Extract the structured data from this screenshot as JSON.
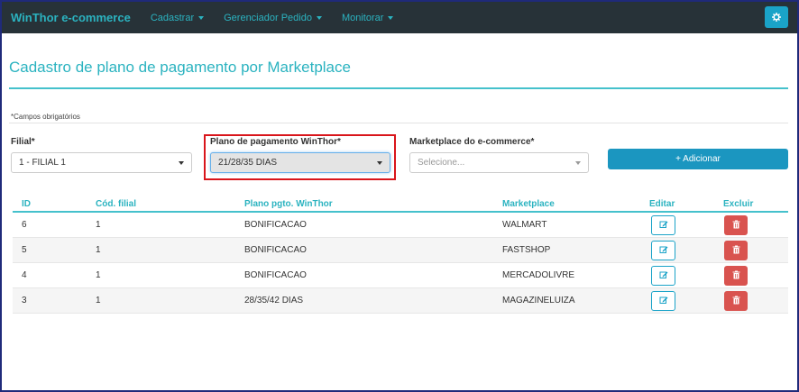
{
  "navbar": {
    "brand": "WinThor e-commerce",
    "items": [
      {
        "label": "Cadastrar"
      },
      {
        "label": "Gerenciador Pedido"
      },
      {
        "label": "Monitorar"
      }
    ],
    "settings_icon": "gear-icon"
  },
  "page": {
    "title": "Cadastro de plano de pagamento por Marketplace",
    "required_note": "*Campos obrigatórios"
  },
  "form": {
    "filial": {
      "label": "Filial*",
      "value": "1 - FILIAL 1"
    },
    "plano": {
      "label": "Plano de pagamento WinThor*",
      "value": "21/28/35 DIAS"
    },
    "marketplace": {
      "label": "Marketplace do e-commerce*",
      "placeholder": "Selecione..."
    },
    "add_button": "+ Adicionar"
  },
  "table": {
    "headers": {
      "id": "ID",
      "cod_filial": "Cód. filial",
      "plano": "Plano pgto. WinThor",
      "marketplace": "Marketplace",
      "editar": "Editar",
      "excluir": "Excluir"
    },
    "rows": [
      {
        "id": "6",
        "filial": "1",
        "plano": "BONIFICACAO",
        "marketplace": "WALMART"
      },
      {
        "id": "5",
        "filial": "1",
        "plano": "BONIFICACAO",
        "marketplace": "FASTSHOP"
      },
      {
        "id": "4",
        "filial": "1",
        "plano": "BONIFICACAO",
        "marketplace": "MERCADOLIVRE"
      },
      {
        "id": "3",
        "filial": "1",
        "plano": "28/35/42 DIAS",
        "marketplace": "MAGAZINELUIZA"
      }
    ]
  },
  "colors": {
    "navbar_bg": "#273238",
    "accent": "#2bb3c0",
    "primary_button": "#1b96c0",
    "danger": "#d9534f",
    "highlight": "#d9151b"
  }
}
